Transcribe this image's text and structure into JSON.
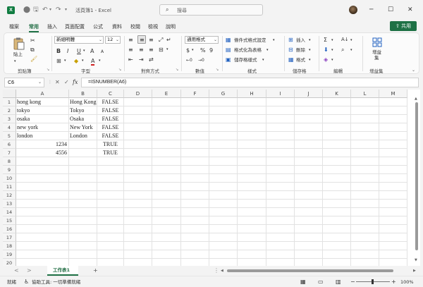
{
  "window": {
    "app_icon_letter": "X",
    "title": "活頁簿1 - Excel",
    "search_placeholder": "搜尋",
    "minimize": "─",
    "maximize": "☐",
    "close": "✕",
    "quick_access": {
      "save": "🖫",
      "undo": "↶",
      "redo": "↷",
      "more": "▾"
    }
  },
  "menu": {
    "tabs": [
      "檔案",
      "常用",
      "插入",
      "頁面配置",
      "公式",
      "資料",
      "校閱",
      "檢視",
      "說明"
    ],
    "active_tab": "常用",
    "share_label": "共用"
  },
  "ribbon": {
    "groups": [
      "剪貼簿",
      "字型",
      "對齊方式",
      "數值",
      "樣式",
      "儲存格",
      "編輯",
      "增益集"
    ],
    "clipboard": {
      "paste_label": "貼上"
    },
    "font": {
      "name": "新細明體",
      "size": "12",
      "bold": "B",
      "italic": "I",
      "underline": "U",
      "grow": "A",
      "shrink": "A"
    },
    "number": {
      "format": "通用格式",
      "currency": "$",
      "percent": "%",
      "comma": "9"
    },
    "styles": {
      "conditional": "條件式格式設定",
      "as_table": "格式化為表格",
      "cell_styles": "儲存格樣式"
    },
    "cells": {
      "insert": "插入",
      "delete": "刪除",
      "format": "格式"
    },
    "editing": {
      "sum": "Σ",
      "sort": "A↓",
      "find": "⌕"
    },
    "addins": {
      "label_line1": "增益",
      "label_line2": "集"
    }
  },
  "formula_bar": {
    "name_box": "C6",
    "fx_label": "fx",
    "cancel": "✕",
    "enter": "✓",
    "content": "=ISNUMBER(A6)"
  },
  "sheet": {
    "columns": [
      "A",
      "B",
      "C",
      "D",
      "E",
      "F",
      "G",
      "H",
      "I",
      "J",
      "K",
      "L",
      "M"
    ],
    "row_count": 20,
    "cells": {
      "A": [
        "hong kong",
        "tokyo",
        "osaka",
        "new york",
        "london",
        "1234",
        "4556"
      ],
      "B": [
        "Hong Kong",
        "Tokyo",
        "Osaka",
        "New York",
        "London",
        "",
        ""
      ],
      "C": [
        "FALSE",
        "FALSE",
        "FALSE",
        "FALSE",
        "FALSE",
        "TRUE",
        "TRUE"
      ]
    }
  },
  "tabs": {
    "sheet_name": "工作表1",
    "add": "+",
    "prev": "<",
    "next": ">",
    "scroll_dots": "⋮"
  },
  "status": {
    "ready": "就緒",
    "accessibility": "協助工具: 一切準備就緒",
    "zoom": "100%",
    "zoom_minus": "−",
    "zoom_plus": "+"
  },
  "colors": {
    "accent": "#1e7145",
    "excel_green": "#107c41"
  }
}
